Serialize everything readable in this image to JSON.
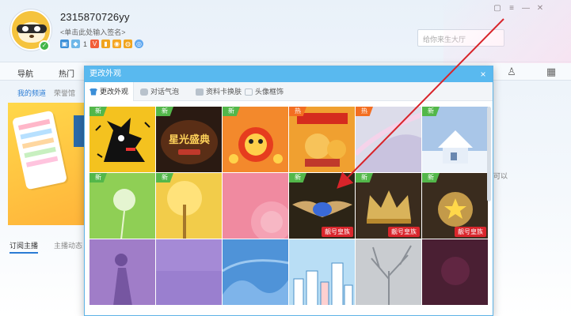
{
  "profile": {
    "username": "2315870726yy",
    "signature": "<单击此处输入签名>",
    "badge_count": "1"
  },
  "search": {
    "placeholder": "给你来生大厅"
  },
  "nav": {
    "items": [
      "导航",
      "热门"
    ]
  },
  "subnav": {
    "items": [
      "我的频道",
      "荣誉馆"
    ]
  },
  "bottom_tabs": {
    "items": [
      "订阅主播",
      "主播动态"
    ]
  },
  "edge_text": "可以",
  "dialog": {
    "title": "更改外观",
    "close": "×",
    "tabs": [
      "更改外观",
      "对话气泡",
      "资料卡换肤",
      "头像框饰"
    ]
  },
  "tags": {
    "new": "新",
    "hot": "热"
  },
  "ribbon_label": "靓号皇族",
  "skins": [
    {
      "tag": "new",
      "bg": "#f4c21f",
      "kind": "dog"
    },
    {
      "tag": "new",
      "bg": "#2a1a12",
      "kind": "starlight",
      "text": "星光盛典"
    },
    {
      "tag": "new",
      "bg": "#f3892c",
      "kind": "lion"
    },
    {
      "tag": "hot",
      "bg": "#f0a030",
      "kind": "monkey"
    },
    {
      "tag": "hot",
      "bg": "#d8d8e8",
      "kind": "swirl"
    },
    {
      "tag": "new",
      "bg": "#a9c6e8",
      "kind": "house"
    },
    {
      "tag": "new",
      "bg": "#8fcf55",
      "kind": "dandelion"
    },
    {
      "tag": "new",
      "bg": "#f2cc4a",
      "kind": "tree"
    },
    {
      "tag": "",
      "bg": "#f08aa0",
      "kind": "swirlpink"
    },
    {
      "tag": "new",
      "bg": "#2c2416",
      "kind": "wings",
      "ribbon": true
    },
    {
      "tag": "new",
      "bg": "#3a2c1e",
      "kind": "crown",
      "ribbon": true
    },
    {
      "tag": "new",
      "bg": "#3a2c1e",
      "kind": "crownstar",
      "ribbon": true
    },
    {
      "tag": "",
      "bg": "#a07dc8",
      "kind": "girl"
    },
    {
      "tag": "",
      "bg": "#9a7fcf",
      "kind": "plain"
    },
    {
      "tag": "",
      "bg": "#4f93d8",
      "kind": "waves"
    },
    {
      "tag": "",
      "bg": "#b9def5",
      "kind": "city"
    },
    {
      "tag": "",
      "bg": "#c9ccd0",
      "kind": "branches"
    },
    {
      "tag": "",
      "bg": "#4a1f33",
      "kind": "dark"
    }
  ]
}
